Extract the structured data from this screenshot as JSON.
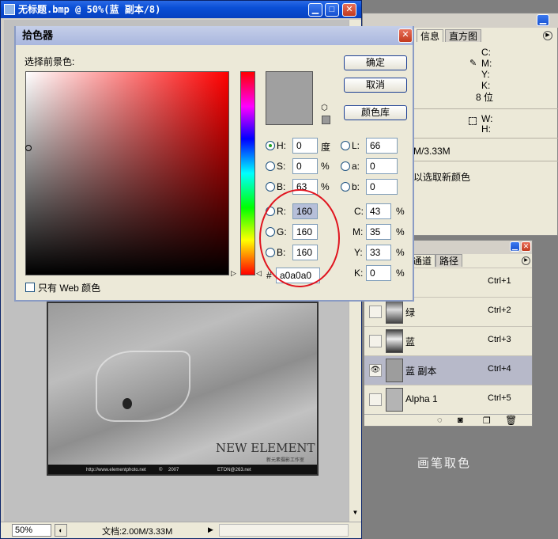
{
  "doc_window": {
    "title": "无标题.bmp @ 50%(蓝 副本/8)",
    "zoom": "50%",
    "doc_size": "文档:2.00M/3.33M",
    "image_text": {
      "brand": "NEW ELEMENT",
      "brand_sub": "新元素摄影工作室",
      "url": "http://www.elementphoto.net",
      "copyright": "©",
      "year": "2007",
      "email": "ETON@263.net"
    }
  },
  "info_panel": {
    "tabs": [
      "信息",
      "直方图"
    ],
    "labels": [
      "C:",
      "M:",
      "Y:",
      "K:",
      "8 位",
      "W:",
      "H:"
    ],
    "size_text": "M/3.33M",
    "hint": "以选取新颜色"
  },
  "channels_panel": {
    "tabs": [
      "通道",
      "路径"
    ],
    "rows": [
      {
        "name": "",
        "shortcut": "Ctrl+1"
      },
      {
        "name": "绿",
        "shortcut": "Ctrl+2"
      },
      {
        "name": "蓝",
        "shortcut": "Ctrl+3"
      },
      {
        "name": "蓝 副本",
        "shortcut": "Ctrl+4"
      },
      {
        "name": "Alpha 1",
        "shortcut": "Ctrl+5"
      }
    ]
  },
  "color_picker": {
    "title": "拾色器",
    "prompt": "选择前景色:",
    "buttons": {
      "ok": "确定",
      "cancel": "取消",
      "library": "颜色库"
    },
    "web_only": "只有 Web 颜色",
    "fields": {
      "H": {
        "label": "H:",
        "value": "0",
        "unit": "度"
      },
      "S": {
        "label": "S:",
        "value": "0",
        "unit": "%"
      },
      "Bv": {
        "label": "B:",
        "value": "63",
        "unit": "%"
      },
      "R": {
        "label": "R:",
        "value": "160"
      },
      "G": {
        "label": "G:",
        "value": "160"
      },
      "B": {
        "label": "B:",
        "value": "160"
      },
      "L": {
        "label": "L:",
        "value": "66"
      },
      "a": {
        "label": "a:",
        "value": "0"
      },
      "b": {
        "label": "b:",
        "value": "0"
      },
      "C": {
        "label": "C:",
        "value": "43",
        "unit": "%"
      },
      "M": {
        "label": "M:",
        "value": "35",
        "unit": "%"
      },
      "Y": {
        "label": "Y:",
        "value": "33",
        "unit": "%"
      },
      "K": {
        "label": "K:",
        "value": "0",
        "unit": "%"
      },
      "hex": {
        "label": "#",
        "value": "a0a0a0"
      }
    },
    "swatch_color": "#a0a0a0"
  },
  "caption": "画笔取色",
  "colors": {
    "highlight_circle": "#e0141e",
    "title_blue": "#0a4fd6"
  }
}
